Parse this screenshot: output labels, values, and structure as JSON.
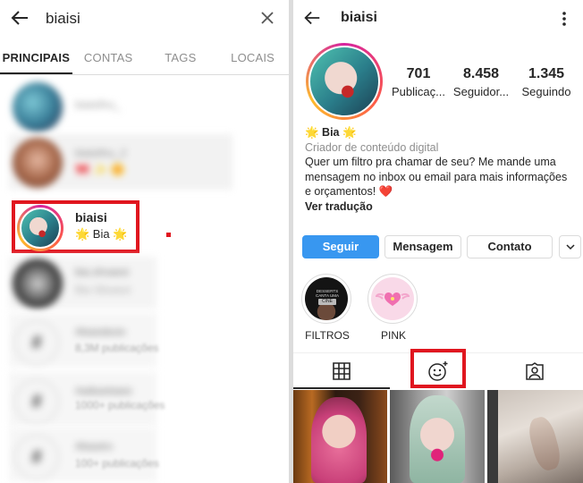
{
  "search": {
    "query": "biaisi",
    "tabs": [
      "PRINCIPAIS",
      "CONTAS",
      "TAGS",
      "LOCAIS"
    ]
  },
  "results": [
    {
      "name": "biaisifnu_",
      "sub": ""
    },
    {
      "name": "biaisifnu_2",
      "sub": "🎀 ✨ 🌼"
    },
    {
      "name": "biaisi",
      "sub": "🌟 Bia 🌟"
    },
    {
      "name": "bia.shvaesi",
      "sub": "Bia Silvaesi"
    },
    {
      "name": "#biaisiboin",
      "sub": "8,3M publicações"
    },
    {
      "name": "#aiibarbiaisi",
      "sub": "1000+ publicações"
    },
    {
      "name": "#biaslro",
      "sub": "100+ publicações"
    }
  ],
  "profile": {
    "username": "biaisi",
    "stats": [
      {
        "value": "701",
        "label": "Publicaç..."
      },
      {
        "value": "8.458",
        "label": "Seguidor..."
      },
      {
        "value": "1.345",
        "label": "Seguindo"
      }
    ],
    "name": "🌟 Bia 🌟",
    "category": "Criador de conteúdo digital",
    "bio": "Quer um filtro pra chamar de seu? Me mande uma mensagem no inbox ou email  para mais informações e orçamentos! ❤️",
    "translate": "Ver tradução",
    "buttons": {
      "follow": "Seguir",
      "message": "Mensagem",
      "contact": "Contato"
    },
    "highlights": [
      {
        "label": "FILTROS",
        "caption": "DESSERTS CANTA UMA MUSICA",
        "tag": "CINE"
      },
      {
        "label": "PINK"
      }
    ]
  },
  "colors": {
    "accent": "#3897f0",
    "highlight_box": "#e0161f"
  }
}
